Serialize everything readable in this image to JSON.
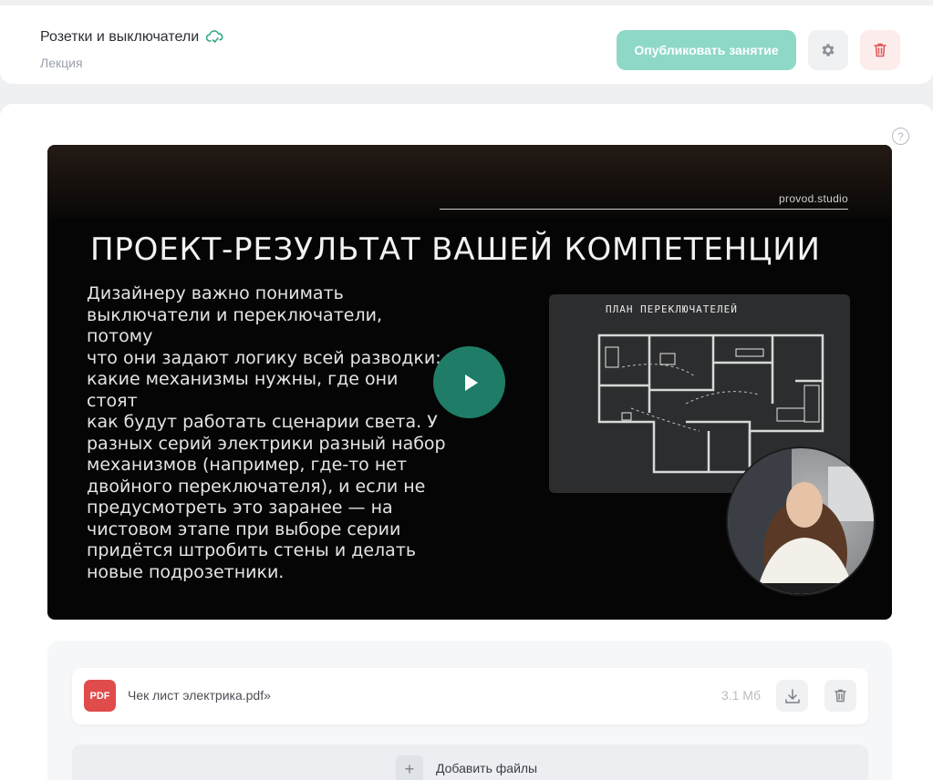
{
  "header": {
    "lesson_title": "Розетки и выключатели",
    "lesson_type": "Лекция",
    "publish_label": "Опубликовать занятие",
    "accent_color": "#8ed8c7",
    "icons": [
      "cloud-sync-icon",
      "gear-icon",
      "trash-icon"
    ]
  },
  "help": {
    "symbol": "?"
  },
  "video": {
    "brand": "provod.studio",
    "heading": "ПРОЕКТ-РЕЗУЛЬТАТ ВАШЕЙ КОМПЕТЕНЦИИ",
    "body_lines": [
      "Дизайнеру важно понимать",
      "выключатели и переключатели, потому",
      "что они задают логику всей разводки:",
      "какие механизмы нужны, где они стоят",
      "как будут работать сценарии света. У",
      "разных серий электрики разный набор",
      "механизмов (например, где-то нет",
      "двойного переключателя), и если не",
      "предусмотреть это заранее — на",
      "чистовом этапе при выборе серии",
      "придётся штробить стены и делать",
      "новые подрозетники."
    ],
    "plan_title": "ПЛАН   ПЕРЕКЛЮЧАТЕЛЕЙ",
    "play_color": "#1f7d67"
  },
  "files": {
    "items": [
      {
        "badge": "PDF",
        "name": "Чек лист электрика.pdf»",
        "size": "3.1 Мб"
      }
    ],
    "add_label": "Добавить файлы",
    "add_symbol": "+"
  }
}
